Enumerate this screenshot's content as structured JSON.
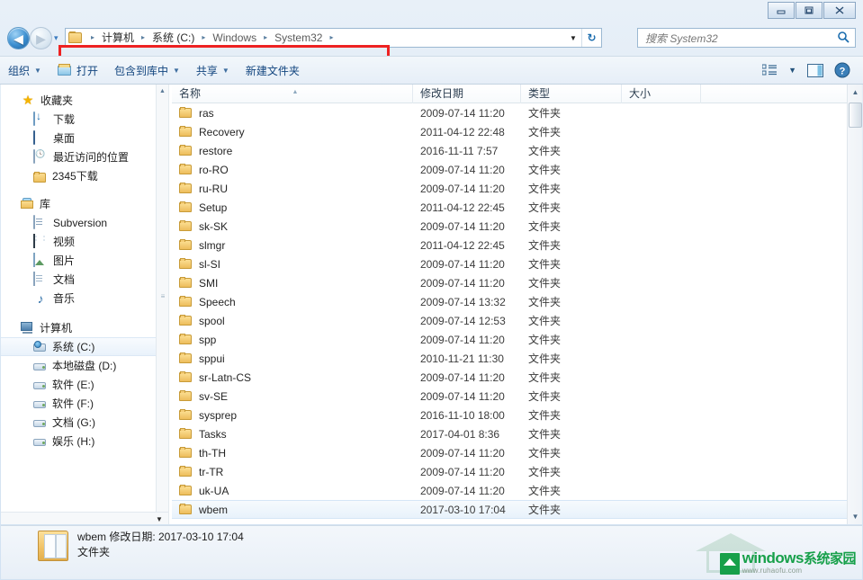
{
  "window": {
    "controls": {
      "minimize": "minimize-button",
      "maximize": "maximize-button",
      "close": "close-button"
    }
  },
  "addressbar": {
    "back_arrow": "◀",
    "forward_arrow": "▶",
    "nav_dropdown": "▾",
    "crumbs": [
      {
        "label": "计算机"
      },
      {
        "label": "系统 (C:)"
      },
      {
        "label": "Windows"
      },
      {
        "label": "System32"
      }
    ],
    "separator": "▸",
    "dropdown_caret": "▼",
    "refresh_icon": "↻"
  },
  "search": {
    "placeholder": "搜索 System32",
    "icon": "search-icon"
  },
  "commandbar": {
    "organize": "组织",
    "open": "打开",
    "include_in_library": "包含到库中",
    "share": "共享",
    "new_folder": "新建文件夹",
    "caret": "▼",
    "view_icon": "view-list-icon",
    "preview_icon": "preview-pane-icon",
    "help_icon": "help-icon"
  },
  "navpane": {
    "groups": [
      {
        "name": "favorites",
        "header": {
          "label": "收藏夹",
          "icon": "star-icon"
        },
        "items": [
          {
            "label": "下载",
            "icon": "download-icon"
          },
          {
            "label": "桌面",
            "icon": "desktop-icon"
          },
          {
            "label": "最近访问的位置",
            "icon": "recent-places-icon"
          },
          {
            "label": "2345下载",
            "icon": "folder-icon"
          }
        ]
      },
      {
        "name": "libraries",
        "header": {
          "label": "库",
          "icon": "library-icon"
        },
        "items": [
          {
            "label": "Subversion",
            "icon": "subversion-icon"
          },
          {
            "label": "视频",
            "icon": "video-icon"
          },
          {
            "label": "图片",
            "icon": "pictures-icon"
          },
          {
            "label": "文档",
            "icon": "documents-icon"
          },
          {
            "label": "音乐",
            "icon": "music-icon"
          }
        ]
      },
      {
        "name": "computer",
        "header": {
          "label": "计算机",
          "icon": "computer-icon"
        },
        "items": [
          {
            "label": "系统 (C:)",
            "icon": "system-drive-icon",
            "selected": true
          },
          {
            "label": "本地磁盘 (D:)",
            "icon": "drive-icon"
          },
          {
            "label": "软件 (E:)",
            "icon": "drive-icon"
          },
          {
            "label": "软件 (F:)",
            "icon": "drive-icon"
          },
          {
            "label": "文档 (G:)",
            "icon": "drive-icon"
          },
          {
            "label": "娱乐 (H:)",
            "icon": "drive-icon"
          }
        ]
      }
    ],
    "scroll_up": "▲",
    "scroll_down": "▼",
    "scroll_grip": "≡",
    "hscroll_caret": "▼"
  },
  "filelist": {
    "columns": [
      {
        "key": "name",
        "label": "名称",
        "sorted": true,
        "sort_arrow": "▲"
      },
      {
        "key": "date",
        "label": "修改日期"
      },
      {
        "key": "type",
        "label": "类型"
      },
      {
        "key": "size",
        "label": "大小"
      }
    ],
    "rows": [
      {
        "name": "ras",
        "date": "2009-07-14 11:20",
        "type": "文件夹",
        "size": "",
        "icon": "folder-icon"
      },
      {
        "name": "Recovery",
        "date": "2011-04-12 22:48",
        "type": "文件夹",
        "size": "",
        "icon": "folder-icon"
      },
      {
        "name": "restore",
        "date": "2016-11-11 7:57",
        "type": "文件夹",
        "size": "",
        "icon": "folder-icon"
      },
      {
        "name": "ro-RO",
        "date": "2009-07-14 11:20",
        "type": "文件夹",
        "size": "",
        "icon": "folder-icon"
      },
      {
        "name": "ru-RU",
        "date": "2009-07-14 11:20",
        "type": "文件夹",
        "size": "",
        "icon": "folder-icon"
      },
      {
        "name": "Setup",
        "date": "2011-04-12 22:45",
        "type": "文件夹",
        "size": "",
        "icon": "folder-icon"
      },
      {
        "name": "sk-SK",
        "date": "2009-07-14 11:20",
        "type": "文件夹",
        "size": "",
        "icon": "folder-icon"
      },
      {
        "name": "slmgr",
        "date": "2011-04-12 22:45",
        "type": "文件夹",
        "size": "",
        "icon": "folder-icon"
      },
      {
        "name": "sl-SI",
        "date": "2009-07-14 11:20",
        "type": "文件夹",
        "size": "",
        "icon": "folder-icon"
      },
      {
        "name": "SMI",
        "date": "2009-07-14 11:20",
        "type": "文件夹",
        "size": "",
        "icon": "folder-icon"
      },
      {
        "name": "Speech",
        "date": "2009-07-14 13:32",
        "type": "文件夹",
        "size": "",
        "icon": "folder-icon"
      },
      {
        "name": "spool",
        "date": "2009-07-14 12:53",
        "type": "文件夹",
        "size": "",
        "icon": "folder-icon"
      },
      {
        "name": "spp",
        "date": "2009-07-14 11:20",
        "type": "文件夹",
        "size": "",
        "icon": "folder-icon"
      },
      {
        "name": "sppui",
        "date": "2010-11-21 11:30",
        "type": "文件夹",
        "size": "",
        "icon": "folder-icon"
      },
      {
        "name": "sr-Latn-CS",
        "date": "2009-07-14 11:20",
        "type": "文件夹",
        "size": "",
        "icon": "folder-icon"
      },
      {
        "name": "sv-SE",
        "date": "2009-07-14 11:20",
        "type": "文件夹",
        "size": "",
        "icon": "folder-icon"
      },
      {
        "name": "sysprep",
        "date": "2016-11-10 18:00",
        "type": "文件夹",
        "size": "",
        "icon": "folder-icon"
      },
      {
        "name": "Tasks",
        "date": "2017-04-01 8:36",
        "type": "文件夹",
        "size": "",
        "icon": "folder-icon"
      },
      {
        "name": "th-TH",
        "date": "2009-07-14 11:20",
        "type": "文件夹",
        "size": "",
        "icon": "folder-icon"
      },
      {
        "name": "tr-TR",
        "date": "2009-07-14 11:20",
        "type": "文件夹",
        "size": "",
        "icon": "folder-icon"
      },
      {
        "name": "uk-UA",
        "date": "2009-07-14 11:20",
        "type": "文件夹",
        "size": "",
        "icon": "folder-icon"
      },
      {
        "name": "wbem",
        "date": "2017-03-10 17:04",
        "type": "文件夹",
        "size": "",
        "icon": "folder-icon",
        "selected": true
      }
    ],
    "scroll_up": "▲",
    "scroll_down": "▼"
  },
  "details": {
    "line1": "wbem 修改日期: 2017-03-10 17:04",
    "line2": "文件夹",
    "icon": "folder-large-icon"
  },
  "watermark": {
    "brand": "windows",
    "brand_cn": "系统家园",
    "url": "www.ruhaofu.com"
  },
  "annotation": {
    "color": "#ee2222",
    "target": "address-bar"
  }
}
